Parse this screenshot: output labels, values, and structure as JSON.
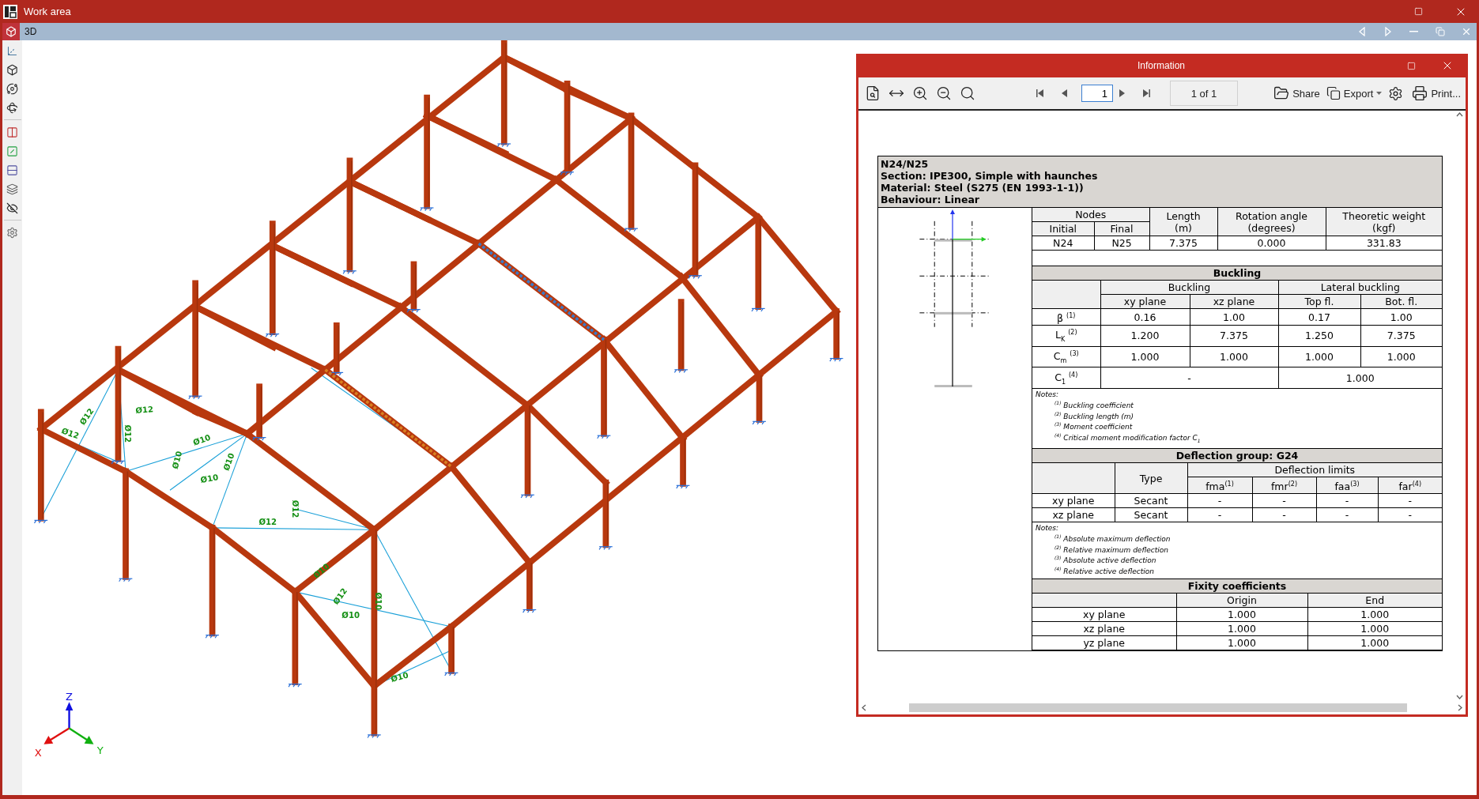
{
  "window": {
    "title": "Work area"
  },
  "view_tab": {
    "label": "3D"
  },
  "model_view": {
    "bracing_labels": [
      "Ø12",
      "Ø12",
      "Ø12",
      "Ø12",
      "Ø10",
      "Ø10",
      "Ø10",
      "Ø10",
      "Ø12",
      "Ø12",
      "Ø12",
      "Ø10",
      "Ø10",
      "Ø10",
      "Ø10"
    ],
    "axes": [
      {
        "label": "Z",
        "kind": "z"
      },
      {
        "label": "X",
        "kind": "x"
      },
      {
        "label": "Y",
        "kind": "y"
      }
    ]
  },
  "info_window": {
    "title": "Information",
    "toolbar": {
      "page": "1",
      "page_count": "1 of 1",
      "tools": [
        {
          "kind": "share",
          "label": "Share",
          "dropdown": false
        },
        {
          "kind": "export",
          "label": "Export",
          "dropdown": true
        },
        {
          "kind": "settings",
          "dropdown": false
        },
        {
          "kind": "print",
          "label": "Print...",
          "dropdown": false
        }
      ]
    },
    "report": {
      "header": [
        "N24/N25",
        "Section: IPE300, Simple with haunches",
        "Material: Steel (S275 (EN 1993-1-1))",
        "Behaviour: Linear"
      ],
      "properties": {
        "nodes_header": "Nodes",
        "nodes_columns": [
          "Initial",
          "Final"
        ],
        "columns": [
          [
            "Length",
            "(m)"
          ],
          [
            "Rotation angle",
            "(degrees)"
          ],
          [
            "Theoretic weight",
            "(kgf)"
          ]
        ],
        "values": [
          "N24",
          "N25",
          "7.375",
          "0.000",
          "331.83"
        ]
      },
      "buckling": {
        "title": "Buckling",
        "groups": [
          {
            "label": "Buckling",
            "columns": [
              "xy plane",
              "xz plane"
            ]
          },
          {
            "label": "Lateral buckling",
            "columns": [
              "Top fl.",
              "Bot. fl."
            ]
          }
        ],
        "rows": [
          {
            "label": "β $^{(1)}$",
            "values": [
              "0.16",
              "1.00",
              "0.17",
              "1.00"
            ]
          },
          {
            "label": "L$_{K}$ $^{(2)}$",
            "values": [
              "1.200",
              "7.375",
              "1.250",
              "7.375"
            ]
          },
          {
            "label": "C$_{m}$ $^{(3)}$",
            "values": [
              "1.000",
              "1.000",
              "1.000",
              "1.000"
            ]
          },
          {
            "label": "C$_{1}$ $^{(4)}$",
            "values": [
              "-",
              "1.000"
            ]
          }
        ],
        "notes_label": "Notes:",
        "notes": [
          "$^{(1)}$ Buckling coefficient",
          "$^{(2)}$ Buckling length (m)",
          "$^{(3)}$ Moment coefficient",
          "$^{(4)}$ Critical moment modification factor C$_{1}$"
        ]
      },
      "deflection": {
        "title": "Deflection group: G24",
        "type_label": "Type",
        "limits_label": "Deflection limits",
        "limit_columns": [
          "fma$^{(1)}$",
          "fmr$^{(2)}$",
          "faa$^{(3)}$",
          "far$^{(4)}$"
        ],
        "rows": [
          {
            "label": "xy plane",
            "type": "Secant",
            "values": [
              "-",
              "-",
              "-",
              "-"
            ]
          },
          {
            "label": "xz plane",
            "type": "Secant",
            "values": [
              "-",
              "-",
              "-",
              "-"
            ]
          }
        ],
        "notes_label": "Notes:",
        "notes": [
          "$^{(1)}$ Absolute maximum deflection",
          "$^{(2)}$ Relative maximum deflection",
          "$^{(3)}$ Absolute active deflection",
          "$^{(4)}$ Relative active deflection"
        ]
      },
      "fixity": {
        "title": "Fixity coefficients",
        "columns": [
          "Origin",
          "End"
        ],
        "rows": [
          {
            "label": "xy plane",
            "values": [
              "1.000",
              "1.000"
            ]
          },
          {
            "label": "xz plane",
            "values": [
              "1.000",
              "1.000"
            ]
          },
          {
            "label": "yz plane",
            "values": [
              "1.000",
              "1.000"
            ]
          }
        ]
      }
    }
  }
}
